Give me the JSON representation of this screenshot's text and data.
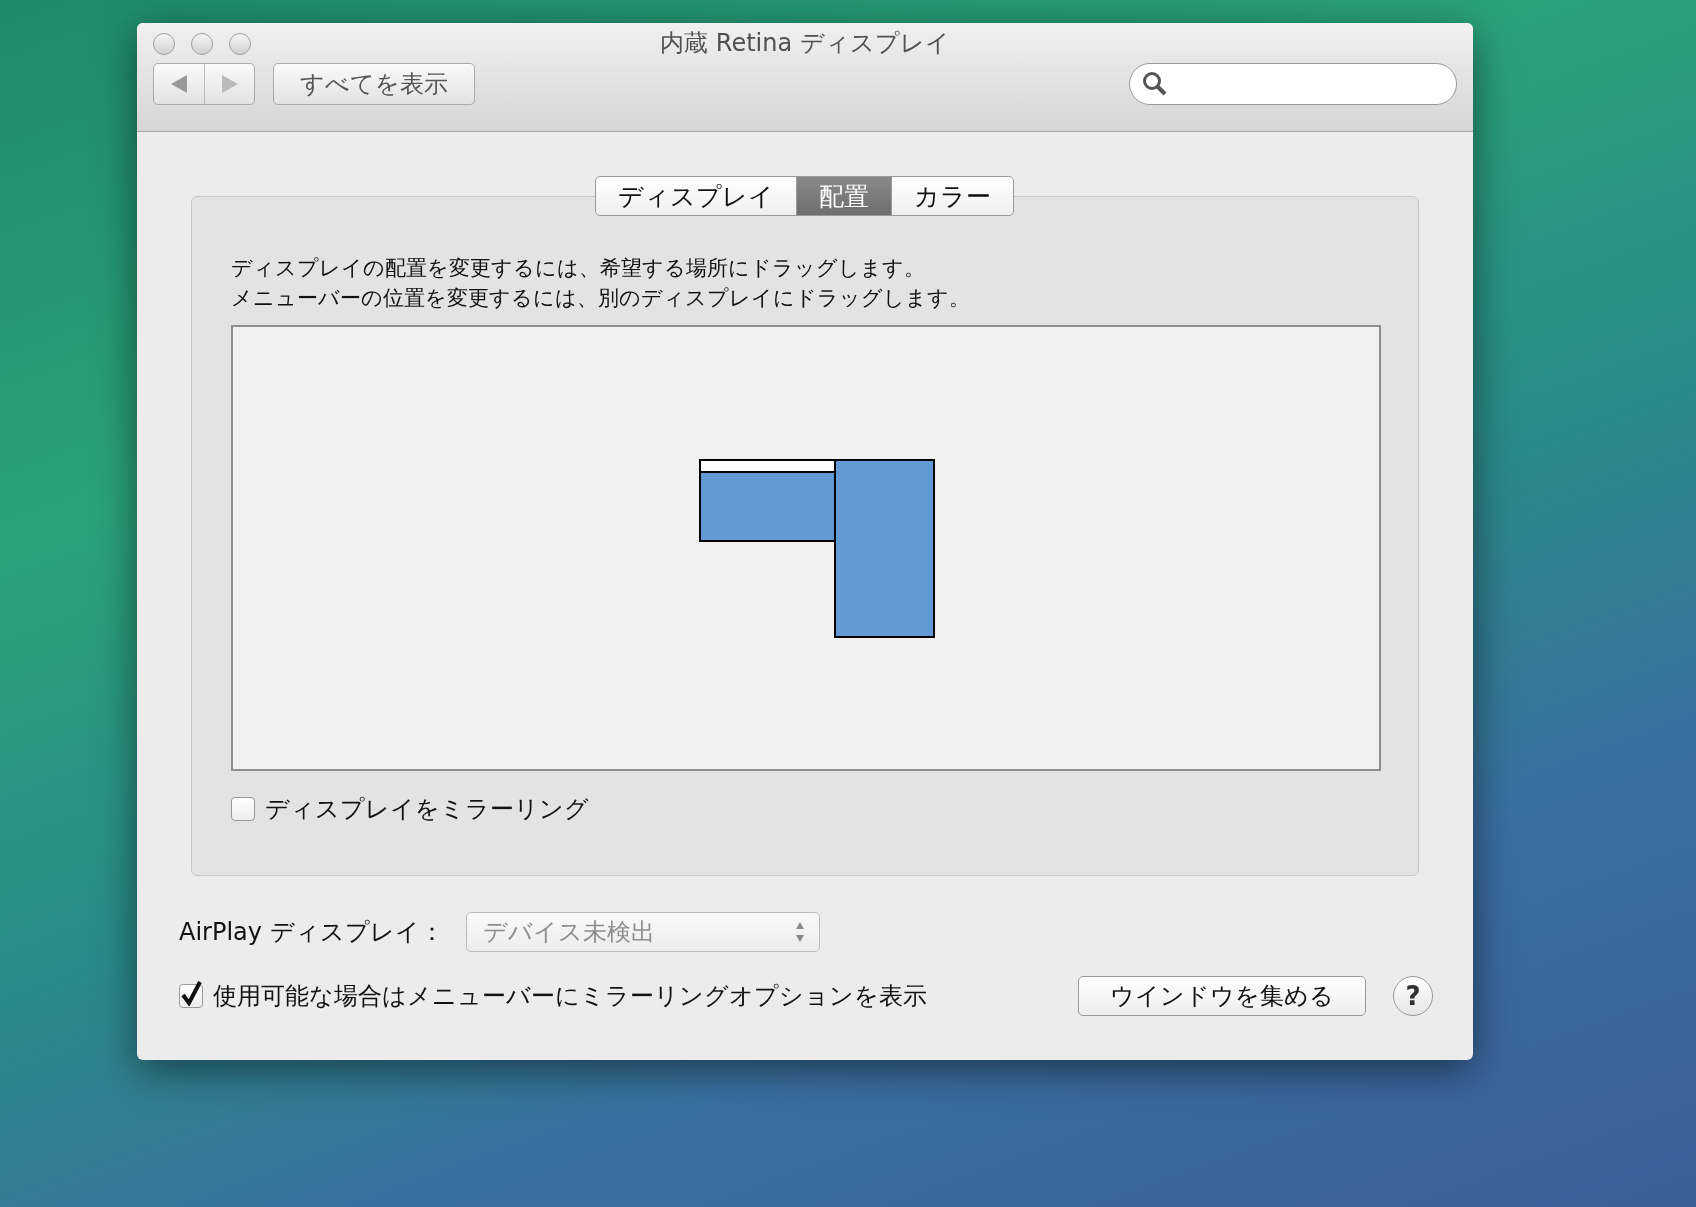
{
  "window": {
    "title": "内蔵 Retina ディスプレイ"
  },
  "toolbar": {
    "show_all_button": "すべてを表示"
  },
  "tabs": [
    {
      "label": "ディスプレイ",
      "selected": false
    },
    {
      "label": "配置",
      "selected": true
    },
    {
      "label": "カラー",
      "selected": false
    }
  ],
  "instructions": [
    "ディスプレイの配置を変更するには、希望する場所にドラッグします。",
    "メニューバーの位置を変更するには、別のディスプレイにドラッグします。"
  ],
  "arrangement": {
    "displays": [
      {
        "menu_bar": true
      },
      {
        "menu_bar": false
      }
    ]
  },
  "mirror_checkbox": {
    "label": "ディスプレイをミラーリング",
    "checked": false
  },
  "airplay": {
    "label": "AirPlay ディスプレイ：",
    "value": "デバイス未検出",
    "disabled": true
  },
  "menu_option_checkbox": {
    "label": "使用可能な場合はメニューバーにミラーリングオプションを表示",
    "checked": true
  },
  "gather_button": "ウインドウを集める",
  "help_button": "?"
}
